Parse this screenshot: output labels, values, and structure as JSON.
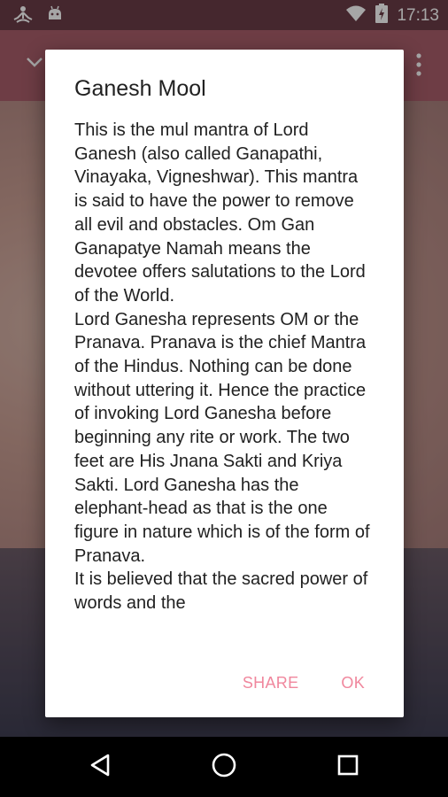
{
  "status_bar": {
    "time": "17:13",
    "icons": [
      "meditation-app-icon",
      "android-notification-icon",
      "wifi-icon",
      "battery-charging-icon"
    ]
  },
  "dialog": {
    "title": "Ganesh Mool",
    "body": "This is the mul mantra of Lord Ganesh (also called Ganapathi, Vinayaka, Vigneshwar). This mantra is said to have the power to remove all evil and obstacles. Om Gan Ganapatye Namah means the devotee offers salutations to the Lord of the World.\nLord Ganesha represents OM or the Pranava. Pranava is the chief Mantra of the Hindus. Nothing can be done without uttering it. Hence the practice of invoking Lord Ganesha before beginning any rite or work. The two feet are His Jnana Sakti and Kriya Sakti. Lord Ganesha has the elephant-head as that is the one figure in nature which is of the form of Pranava.\nIt is believed that the sacred power of words and the",
    "share_label": "SHARE",
    "ok_label": "OK"
  },
  "background_app": {
    "icons": [
      "chevron-down-icon",
      "overflow-menu-icon"
    ]
  },
  "nav_bar": {
    "icons": [
      "back-icon",
      "home-icon",
      "recents-icon"
    ]
  },
  "colors": {
    "accent": "#f0879d",
    "toolbar": "#a95e6b"
  }
}
